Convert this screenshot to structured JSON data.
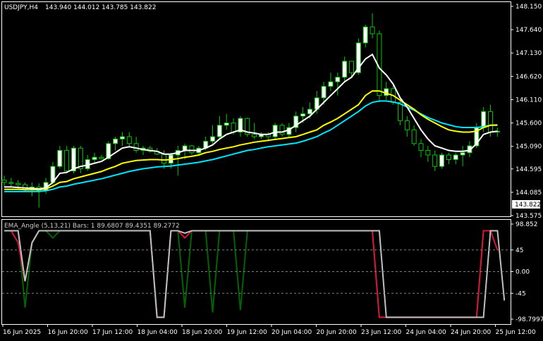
{
  "header": {
    "symbol": "USDJPY,H4",
    "ohlc": "143.940 144.012 143.785 143.822"
  },
  "price_axis": {
    "ticks": [
      "148.150",
      "147.640",
      "147.130",
      "146.620",
      "146.110",
      "145.600",
      "145.090",
      "144.595",
      "144.085",
      "143.575"
    ],
    "current_price": "143.822"
  },
  "indicator": {
    "title": "EMA_Angle (5,13,21) Bars: 1  89.6807  89.4351  89.2772",
    "ticks": [
      "98.852",
      "45",
      "0.00",
      "-45",
      "-98.7997"
    ]
  },
  "time_axis": {
    "labels": [
      "16 Jun 2025",
      "16 Jun 20:00",
      "17 Jun 12:00",
      "18 Jun 04:00",
      "18 Jun 20:00",
      "19 Jun 12:00",
      "20 Jun 04:00",
      "20 Jun 20:00",
      "23 Jun 12:00",
      "24 Jun 04:00",
      "24 Jun 20:00",
      "25 Jun 12:00"
    ]
  },
  "colors": {
    "background": "#000000",
    "bull_candle": "#ffffff",
    "bear_candle": "#000000",
    "candle_wick": "#00c800",
    "ema_fast": "#ffffff",
    "ema_mid": "#ffff00",
    "ema_slow": "#00e5ff",
    "angle_fast": "#dc143c",
    "angle_mid": "#c0c0c0",
    "angle_slow": "#006400",
    "level_line": "#808080"
  },
  "chart_data": [
    {
      "type": "candlestick",
      "title": "USDJPY,H4",
      "ylim": [
        143.575,
        148.15
      ],
      "candles": [
        {
          "o": 144.35,
          "h": 144.45,
          "l": 144.2,
          "c": 144.3
        },
        {
          "o": 144.3,
          "h": 144.4,
          "l": 144.2,
          "c": 144.28
        },
        {
          "o": 144.28,
          "h": 144.35,
          "l": 144.15,
          "c": 144.25
        },
        {
          "o": 144.25,
          "h": 144.3,
          "l": 144.1,
          "c": 144.15
        },
        {
          "o": 144.15,
          "h": 144.3,
          "l": 144.0,
          "c": 144.2
        },
        {
          "o": 144.2,
          "h": 144.28,
          "l": 143.75,
          "c": 144.12
        },
        {
          "o": 144.12,
          "h": 144.4,
          "l": 144.05,
          "c": 144.3
        },
        {
          "o": 144.3,
          "h": 144.75,
          "l": 144.25,
          "c": 144.65
        },
        {
          "o": 144.65,
          "h": 145.1,
          "l": 144.6,
          "c": 145.0
        },
        {
          "o": 145.0,
          "h": 145.1,
          "l": 144.5,
          "c": 144.55
        },
        {
          "o": 144.55,
          "h": 145.1,
          "l": 144.5,
          "c": 145.05
        },
        {
          "o": 145.05,
          "h": 145.1,
          "l": 144.5,
          "c": 144.6
        },
        {
          "o": 144.6,
          "h": 144.9,
          "l": 144.55,
          "c": 144.8
        },
        {
          "o": 144.8,
          "h": 144.95,
          "l": 144.7,
          "c": 144.85
        },
        {
          "o": 144.85,
          "h": 144.9,
          "l": 144.8,
          "c": 144.82
        },
        {
          "o": 144.82,
          "h": 145.2,
          "l": 144.8,
          "c": 145.15
        },
        {
          "o": 145.15,
          "h": 145.3,
          "l": 145.0,
          "c": 145.25
        },
        {
          "o": 145.25,
          "h": 145.4,
          "l": 145.1,
          "c": 145.3
        },
        {
          "o": 145.3,
          "h": 145.4,
          "l": 145.1,
          "c": 145.15
        },
        {
          "o": 145.15,
          "h": 145.3,
          "l": 144.95,
          "c": 145.0
        },
        {
          "o": 145.0,
          "h": 145.1,
          "l": 144.9,
          "c": 145.05
        },
        {
          "o": 145.05,
          "h": 145.1,
          "l": 144.95,
          "c": 144.98
        },
        {
          "o": 144.98,
          "h": 145.05,
          "l": 144.9,
          "c": 144.92
        },
        {
          "o": 144.92,
          "h": 145.0,
          "l": 144.6,
          "c": 144.72
        },
        {
          "o": 144.72,
          "h": 144.95,
          "l": 144.6,
          "c": 144.9
        },
        {
          "o": 144.9,
          "h": 145.1,
          "l": 144.45,
          "c": 145.0
        },
        {
          "o": 145.0,
          "h": 145.15,
          "l": 144.8,
          "c": 145.1
        },
        {
          "o": 145.1,
          "h": 145.12,
          "l": 144.9,
          "c": 144.95
        },
        {
          "o": 144.95,
          "h": 145.1,
          "l": 144.9,
          "c": 145.05
        },
        {
          "o": 145.05,
          "h": 145.3,
          "l": 145.0,
          "c": 145.2
        },
        {
          "o": 145.2,
          "h": 145.55,
          "l": 145.15,
          "c": 145.3
        },
        {
          "o": 145.3,
          "h": 145.75,
          "l": 145.25,
          "c": 145.55
        },
        {
          "o": 145.55,
          "h": 145.8,
          "l": 145.45,
          "c": 145.6
        },
        {
          "o": 145.6,
          "h": 145.7,
          "l": 145.35,
          "c": 145.4
        },
        {
          "o": 145.4,
          "h": 145.75,
          "l": 145.3,
          "c": 145.7
        },
        {
          "o": 145.7,
          "h": 145.72,
          "l": 145.3,
          "c": 145.35
        },
        {
          "o": 145.35,
          "h": 145.6,
          "l": 145.25,
          "c": 145.3
        },
        {
          "o": 145.3,
          "h": 145.4,
          "l": 145.25,
          "c": 145.35
        },
        {
          "o": 145.35,
          "h": 145.4,
          "l": 145.2,
          "c": 145.3
        },
        {
          "o": 145.3,
          "h": 145.6,
          "l": 145.25,
          "c": 145.55
        },
        {
          "o": 145.55,
          "h": 145.6,
          "l": 145.3,
          "c": 145.35
        },
        {
          "o": 145.35,
          "h": 145.6,
          "l": 145.3,
          "c": 145.5
        },
        {
          "o": 145.5,
          "h": 145.85,
          "l": 145.4,
          "c": 145.75
        },
        {
          "o": 145.75,
          "h": 145.95,
          "l": 145.6,
          "c": 145.8
        },
        {
          "o": 145.8,
          "h": 146.05,
          "l": 145.7,
          "c": 145.9
        },
        {
          "o": 145.9,
          "h": 146.3,
          "l": 145.8,
          "c": 146.15
        },
        {
          "o": 146.15,
          "h": 146.5,
          "l": 146.0,
          "c": 146.4
        },
        {
          "o": 146.4,
          "h": 146.7,
          "l": 146.3,
          "c": 146.5
        },
        {
          "o": 146.5,
          "h": 146.7,
          "l": 146.2,
          "c": 146.6
        },
        {
          "o": 146.6,
          "h": 147.05,
          "l": 146.5,
          "c": 146.95
        },
        {
          "o": 146.95,
          "h": 146.95,
          "l": 146.6,
          "c": 146.7
        },
        {
          "o": 146.7,
          "h": 147.45,
          "l": 146.65,
          "c": 147.35
        },
        {
          "o": 147.35,
          "h": 147.75,
          "l": 147.25,
          "c": 147.7
        },
        {
          "o": 147.7,
          "h": 148.0,
          "l": 147.45,
          "c": 147.55
        },
        {
          "o": 147.55,
          "h": 147.62,
          "l": 146.05,
          "c": 146.2
        },
        {
          "o": 146.2,
          "h": 146.5,
          "l": 146.1,
          "c": 146.35
        },
        {
          "o": 146.35,
          "h": 146.45,
          "l": 146.0,
          "c": 146.05
        },
        {
          "o": 146.05,
          "h": 146.1,
          "l": 145.55,
          "c": 145.65
        },
        {
          "o": 145.65,
          "h": 145.75,
          "l": 145.3,
          "c": 145.45
        },
        {
          "o": 145.45,
          "h": 145.55,
          "l": 145.1,
          "c": 145.15
        },
        {
          "o": 145.15,
          "h": 145.25,
          "l": 144.85,
          "c": 145.0
        },
        {
          "o": 145.0,
          "h": 145.1,
          "l": 144.75,
          "c": 144.9
        },
        {
          "o": 144.9,
          "h": 145.0,
          "l": 144.55,
          "c": 144.65
        },
        {
          "o": 144.65,
          "h": 144.95,
          "l": 144.6,
          "c": 144.9
        },
        {
          "o": 144.9,
          "h": 144.95,
          "l": 144.7,
          "c": 144.8
        },
        {
          "o": 144.8,
          "h": 144.95,
          "l": 144.7,
          "c": 144.9
        },
        {
          "o": 144.9,
          "h": 145.1,
          "l": 144.65,
          "c": 144.95
        },
        {
          "o": 144.95,
          "h": 145.2,
          "l": 144.85,
          "c": 145.1
        },
        {
          "o": 145.1,
          "h": 145.6,
          "l": 145.05,
          "c": 145.5
        },
        {
          "o": 145.5,
          "h": 145.95,
          "l": 145.4,
          "c": 145.85
        },
        {
          "o": 145.85,
          "h": 146.0,
          "l": 145.3,
          "c": 145.4
        },
        {
          "o": 145.4,
          "h": 145.5,
          "l": 145.3,
          "c": 145.42
        }
      ],
      "ema_fast": [
        144.2,
        144.2,
        144.19,
        144.18,
        144.17,
        144.16,
        144.18,
        144.3,
        144.5,
        144.52,
        144.6,
        144.65,
        144.68,
        144.72,
        144.76,
        144.85,
        144.95,
        145.05,
        145.08,
        145.05,
        145.02,
        145.0,
        144.98,
        144.92,
        144.92,
        144.95,
        145.0,
        145.0,
        145.0,
        145.05,
        145.12,
        145.25,
        145.35,
        145.4,
        145.45,
        145.4,
        145.38,
        145.35,
        145.35,
        145.4,
        145.4,
        145.45,
        145.55,
        145.65,
        145.75,
        145.9,
        146.05,
        146.2,
        146.35,
        146.5,
        146.6,
        146.8,
        147.0,
        147.1,
        146.8,
        146.65,
        146.45,
        146.15,
        145.95,
        145.7,
        145.45,
        145.25,
        145.1,
        145.05,
        145.0,
        144.98,
        144.98,
        145.0,
        145.15,
        145.35,
        145.4,
        145.42
      ],
      "ema_mid": [
        144.15,
        144.15,
        144.15,
        144.14,
        144.14,
        144.14,
        144.16,
        144.22,
        144.3,
        144.32,
        144.38,
        144.42,
        144.46,
        144.5,
        144.54,
        144.6,
        144.65,
        144.72,
        144.75,
        144.78,
        144.79,
        144.8,
        144.8,
        144.79,
        144.8,
        144.82,
        144.85,
        144.87,
        144.9,
        144.95,
        144.98,
        145.02,
        145.05,
        145.08,
        145.12,
        145.15,
        145.18,
        145.2,
        145.22,
        145.24,
        145.26,
        145.28,
        145.3,
        145.35,
        145.4,
        145.45,
        145.55,
        145.62,
        145.7,
        145.8,
        145.9,
        146.0,
        146.2,
        146.3,
        146.3,
        146.25,
        146.2,
        146.1,
        146.0,
        145.9,
        145.78,
        145.68,
        145.6,
        145.52,
        145.45,
        145.42,
        145.4,
        145.4,
        145.42,
        145.5,
        145.55,
        145.55
      ],
      "ema_slow": [
        144.1,
        144.1,
        144.1,
        144.1,
        144.1,
        144.1,
        144.12,
        144.15,
        144.2,
        144.22,
        144.26,
        144.29,
        144.32,
        144.35,
        144.38,
        144.42,
        144.46,
        144.5,
        144.54,
        144.57,
        144.6,
        144.62,
        144.64,
        144.65,
        144.66,
        144.68,
        144.7,
        144.72,
        144.74,
        144.77,
        144.8,
        144.84,
        144.88,
        144.92,
        144.96,
        145.0,
        145.02,
        145.05,
        145.08,
        145.1,
        145.12,
        145.14,
        145.16,
        145.2,
        145.25,
        145.3,
        145.38,
        145.45,
        145.55,
        145.65,
        145.75,
        145.85,
        145.97,
        146.05,
        146.08,
        146.08,
        146.06,
        146.02,
        145.95,
        145.88,
        145.8,
        145.72,
        145.66,
        145.6,
        145.56,
        145.52,
        145.5,
        145.5,
        145.5,
        145.52,
        145.55,
        145.56
      ]
    },
    {
      "type": "line",
      "title": "EMA_Angle (5,13,21) Bars: 1  89.6807  89.4351  89.2772",
      "ylim": [
        -98.7997,
        98.852
      ],
      "series": [
        {
          "values": [
            85,
            85,
            60,
            -20,
            60,
            85,
            85,
            85,
            85,
            85,
            85,
            85,
            85,
            85,
            85,
            85,
            85,
            85,
            85,
            85,
            85,
            85,
            -95,
            -95,
            85,
            85,
            70,
            85,
            85,
            85,
            85,
            85,
            85,
            85,
            85,
            85,
            85,
            85,
            85,
            85,
            85,
            85,
            85,
            85,
            85,
            85,
            85,
            85,
            85,
            85,
            85,
            85,
            85,
            85,
            -95,
            -95,
            -95,
            -95,
            -95,
            -95,
            -95,
            -95,
            -95,
            -95,
            -95,
            -95,
            -95,
            -95,
            -95,
            85,
            85,
            45
          ]
        },
        {
          "values": [
            85,
            85,
            85,
            -20,
            60,
            85,
            85,
            85,
            85,
            85,
            85,
            85,
            85,
            85,
            85,
            85,
            85,
            85,
            85,
            85,
            85,
            85,
            -95,
            -95,
            85,
            85,
            80,
            85,
            85,
            85,
            85,
            85,
            85,
            85,
            85,
            85,
            85,
            85,
            85,
            85,
            85,
            85,
            85,
            85,
            85,
            85,
            85,
            85,
            85,
            85,
            85,
            85,
            85,
            85,
            85,
            -95,
            -95,
            -95,
            -95,
            -95,
            -95,
            -95,
            -95,
            -95,
            -95,
            -95,
            -95,
            -95,
            -95,
            -95,
            85,
            85,
            -60
          ]
        },
        {
          "values": [
            85,
            85,
            85,
            -75,
            60,
            85,
            85,
            70,
            85,
            85,
            85,
            85,
            85,
            85,
            85,
            85,
            85,
            85,
            85,
            85,
            85,
            85,
            -95,
            -95,
            85,
            85,
            -75,
            85,
            85,
            85,
            -85,
            85,
            85,
            85,
            -80,
            85,
            85,
            85,
            85,
            85,
            85,
            85,
            85,
            85,
            85,
            85,
            85,
            85,
            85,
            85,
            85,
            85,
            85,
            85,
            -95,
            -95,
            -95,
            -95,
            -95,
            -95,
            -95,
            -95,
            -95,
            -95,
            -95,
            -95,
            -95,
            -95,
            -95,
            85,
            85,
            85
          ]
        }
      ]
    }
  ]
}
